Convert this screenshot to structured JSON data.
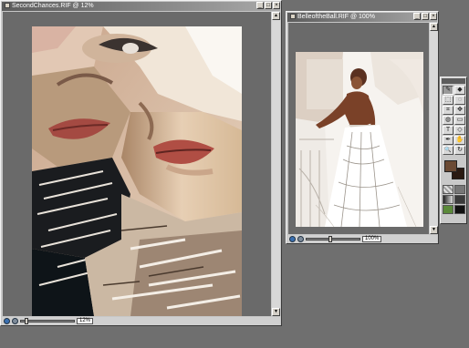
{
  "window_left": {
    "title": "SecondChances.RIF @ 12%",
    "zoom": "12%",
    "buttons": {
      "minimize": "_",
      "maximize": "□",
      "close": "×"
    }
  },
  "window_right": {
    "title": "BelleoftheBall.RIF @ 100%",
    "zoom": "100%",
    "buttons": {
      "minimize": "_",
      "maximize": "□",
      "close": "×"
    }
  },
  "scroll_arrows": {
    "up": "▲",
    "down": "▼"
  },
  "toolbox": {
    "tools": [
      "brush",
      "chalk",
      "select",
      "lasso",
      "crop",
      "move",
      "paint-bucket",
      "eraser",
      "text",
      "shape",
      "dropper",
      "hand",
      "magnifier",
      "rotate"
    ],
    "tool_glyphs": [
      "✎",
      "◆",
      "⬚",
      "◌",
      "⌗",
      "✥",
      "◍",
      "▭",
      "T",
      "◇",
      "✒",
      "✋",
      "🔍",
      "↻"
    ],
    "primary_color": "#6b4a34",
    "secondary_color": "#2a1a12"
  }
}
